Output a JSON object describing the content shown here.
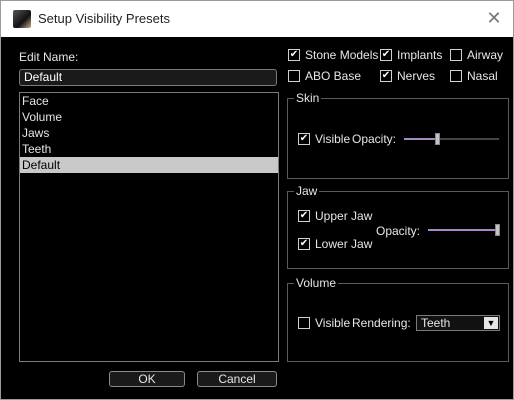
{
  "window": {
    "title": "Setup Visibility Presets"
  },
  "edit_name": {
    "label": "Edit Name:",
    "value": "Default"
  },
  "presets": [
    {
      "label": "Face",
      "selected": false
    },
    {
      "label": "Volume",
      "selected": false
    },
    {
      "label": "Jaws",
      "selected": false
    },
    {
      "label": "Teeth",
      "selected": false
    },
    {
      "label": "Default",
      "selected": true
    }
  ],
  "buttons": {
    "ok": "OK",
    "cancel": "Cancel"
  },
  "toggles": {
    "stone_models": {
      "label": "Stone Models",
      "checked": true
    },
    "implants": {
      "label": "Implants",
      "checked": true
    },
    "airway": {
      "label": "Airway",
      "checked": false
    },
    "abo_base": {
      "label": "ABO Base",
      "checked": false
    },
    "nerves": {
      "label": "Nerves",
      "checked": true
    },
    "nasal": {
      "label": "Nasal",
      "checked": false
    }
  },
  "skin": {
    "title": "Skin",
    "visible_label": "Visible",
    "visible_checked": true,
    "opacity_label": "Opacity:",
    "opacity": 0.35
  },
  "jaw": {
    "title": "Jaw",
    "upper_label": "Upper Jaw",
    "upper_checked": true,
    "lower_label": "Lower Jaw",
    "lower_checked": true,
    "opacity_label": "Opacity:",
    "opacity": 1.0
  },
  "volume": {
    "title": "Volume",
    "visible_label": "Visible",
    "visible_checked": false,
    "rendering_label": "Rendering:",
    "rendering_value": "Teeth"
  },
  "colors": {
    "slider_fill": "#a48bc4",
    "selection": "#c8c8c8"
  }
}
